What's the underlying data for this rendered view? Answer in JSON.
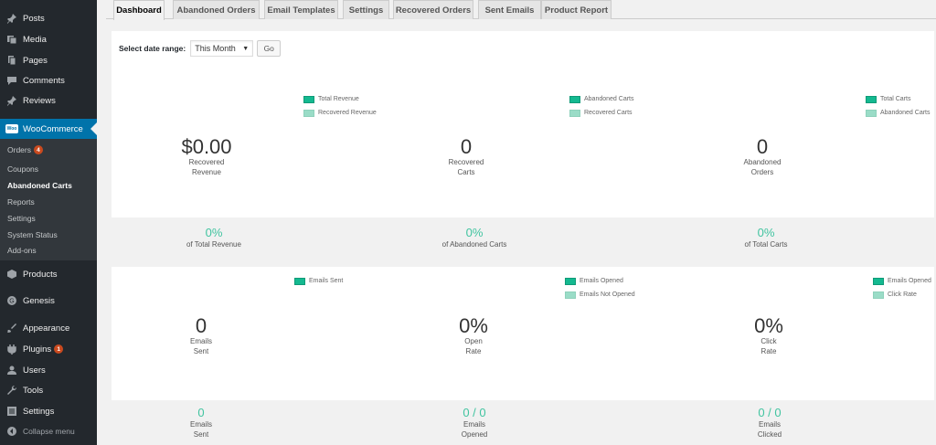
{
  "sidebar": {
    "top_items": [
      {
        "label": "Posts",
        "icon": "pin-icon"
      },
      {
        "label": "Media",
        "icon": "media-icon"
      },
      {
        "label": "Pages",
        "icon": "pages-icon"
      },
      {
        "label": "Comments",
        "icon": "comments-icon"
      },
      {
        "label": "Reviews",
        "icon": "pin-icon"
      }
    ],
    "woocommerce": {
      "label": "WooCommerce",
      "logo": "Woo"
    },
    "submenu": [
      {
        "label": "Orders",
        "badge": "4"
      },
      {
        "label": "Coupons"
      },
      {
        "label": "Abandoned Carts"
      },
      {
        "label": "Reports"
      },
      {
        "label": "Settings"
      },
      {
        "label": "System Status"
      },
      {
        "label": "Add-ons"
      }
    ],
    "bottom_items": [
      {
        "label": "Products"
      },
      {
        "label": "Genesis"
      },
      {
        "label": "Appearance"
      },
      {
        "label": "Plugins",
        "badge": "1"
      },
      {
        "label": "Users"
      },
      {
        "label": "Tools"
      },
      {
        "label": "Settings"
      }
    ],
    "collapse": "Collapse menu"
  },
  "tabs": [
    "Dashboard",
    "Abandoned Orders",
    "Email Templates",
    "Settings",
    "Recovered Orders",
    "Sent Emails",
    "Product Report"
  ],
  "active_tab": "Dashboard",
  "filter": {
    "label": "Select date range:",
    "selected": "This Month",
    "go": "Go"
  },
  "legends": {
    "revenue": [
      "Total Revenue",
      "Recovered Revenue"
    ],
    "carts": [
      "Abandoned Carts",
      "Recovered Carts"
    ],
    "orders": [
      "Total Carts",
      "Abandoned Carts"
    ],
    "sent": [
      "Emails Sent"
    ],
    "opened": [
      "Emails Opened",
      "Emails Not Opened"
    ],
    "clicked": [
      "Emails Opened",
      "Click Rate"
    ]
  },
  "stats": {
    "revenue": {
      "value": "$0.00",
      "label1": "Recovered",
      "label2": "Revenue"
    },
    "carts": {
      "value": "0",
      "label1": "Recovered",
      "label2": "Carts"
    },
    "orders": {
      "value": "0",
      "label1": "Abandoned",
      "label2": "Orders"
    },
    "sent": {
      "value": "0",
      "label1": "Emails",
      "label2": "Sent"
    },
    "open_rate": {
      "value": "0%",
      "label1": "Open",
      "label2": "Rate"
    },
    "click_rate": {
      "value": "0%",
      "label1": "Click",
      "label2": "Rate"
    }
  },
  "percentages": {
    "revenue": {
      "value": "0%",
      "label": "of Total Revenue"
    },
    "carts": {
      "value": "0%",
      "label": "of Abandoned Carts"
    },
    "total_carts": {
      "value": "0%",
      "label": "of Total Carts"
    }
  },
  "email_totals": {
    "sent": {
      "value": "0",
      "label1": "Emails",
      "label2": "Sent"
    },
    "opened": {
      "value": "0 / 0",
      "label1": "Emails",
      "label2": "Opened"
    },
    "clicked": {
      "value": "0 / 0",
      "label1": "Emails",
      "label2": "Clicked"
    }
  },
  "colors": {
    "accent_dark": "#14b990",
    "accent_light": "#9adcc7",
    "sidebar": "#23282d",
    "active": "#0073aa"
  }
}
